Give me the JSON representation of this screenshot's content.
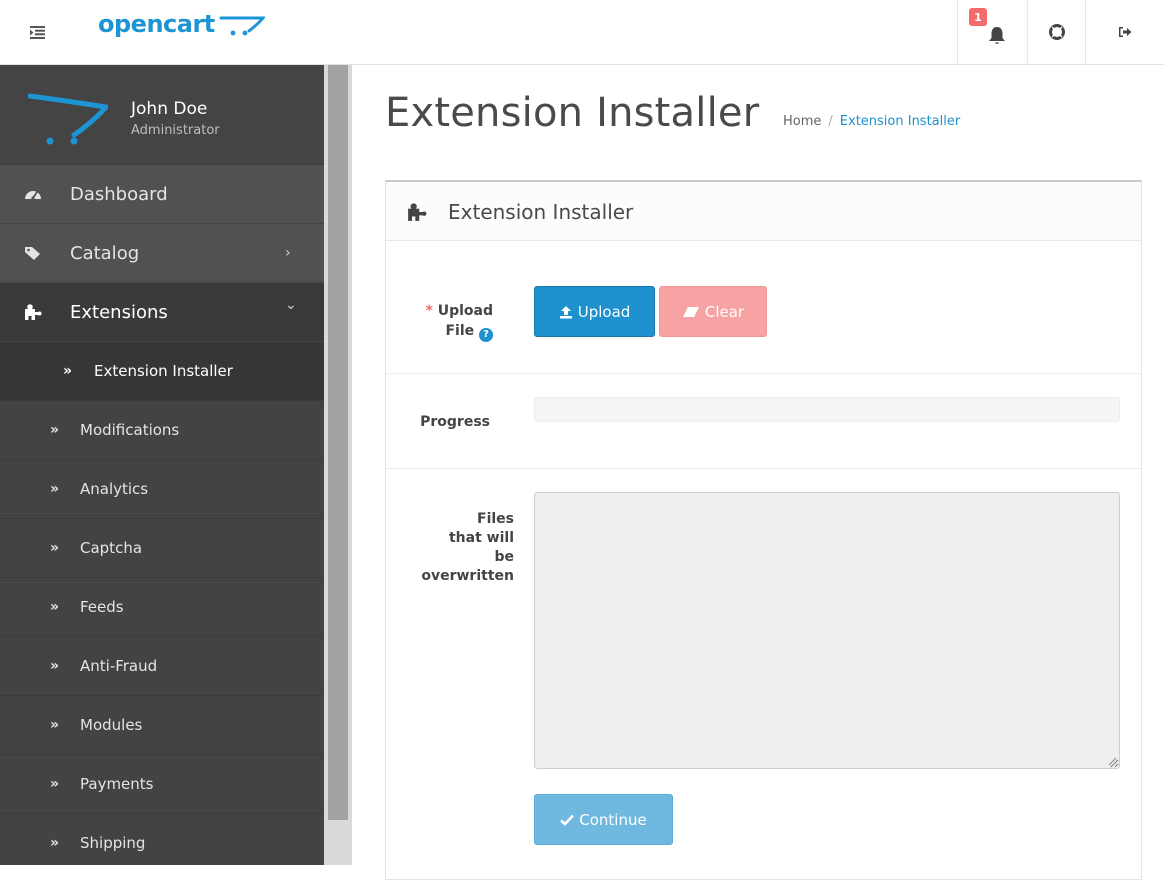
{
  "header": {
    "logo_text": "opencart",
    "notification_count": "1",
    "icons": {
      "menu": "menu-toggle-icon",
      "cart_logo": "cart-logo-icon",
      "bell": "bell-icon",
      "help": "lifebuoy-icon",
      "logout": "sign-out-icon"
    }
  },
  "profile": {
    "name": "John Doe",
    "role": "Administrator"
  },
  "sidebar": {
    "items": [
      {
        "label": "Dashboard",
        "icon": "dashboard-icon"
      },
      {
        "label": "Catalog",
        "icon": "tags-icon",
        "chevron": "›"
      },
      {
        "label": "Extensions",
        "icon": "puzzle-icon",
        "chevron": "⌄"
      }
    ],
    "subitems": [
      {
        "label": "Extension Installer"
      },
      {
        "label": "Modifications"
      },
      {
        "label": "Analytics"
      },
      {
        "label": "Captcha"
      },
      {
        "label": "Feeds"
      },
      {
        "label": "Anti-Fraud"
      },
      {
        "label": "Modules"
      },
      {
        "label": "Payments"
      },
      {
        "label": "Shipping"
      }
    ],
    "sub_arrow": "»"
  },
  "page": {
    "title": "Extension Installer",
    "breadcrumb": {
      "home": "Home",
      "separator": "/",
      "current": "Extension Installer"
    }
  },
  "panel": {
    "title": "Extension Installer",
    "upload": {
      "required_mark": "*",
      "label_line1": "Upload",
      "label_line2": "File",
      "help_icon": "question-circle-icon",
      "upload_button": "Upload",
      "clear_button": "Clear"
    },
    "progress": {
      "label": "Progress",
      "value": 0
    },
    "overwrite": {
      "label_lines": [
        "Files",
        "that will",
        "be",
        "overwritten"
      ],
      "value": ""
    },
    "continue_button": "Continue"
  },
  "colors": {
    "brand_blue": "#1e91cf",
    "danger_light": "#f7a3a3",
    "sidebar_bg": "#515151",
    "badge_red": "#f56b6b"
  }
}
